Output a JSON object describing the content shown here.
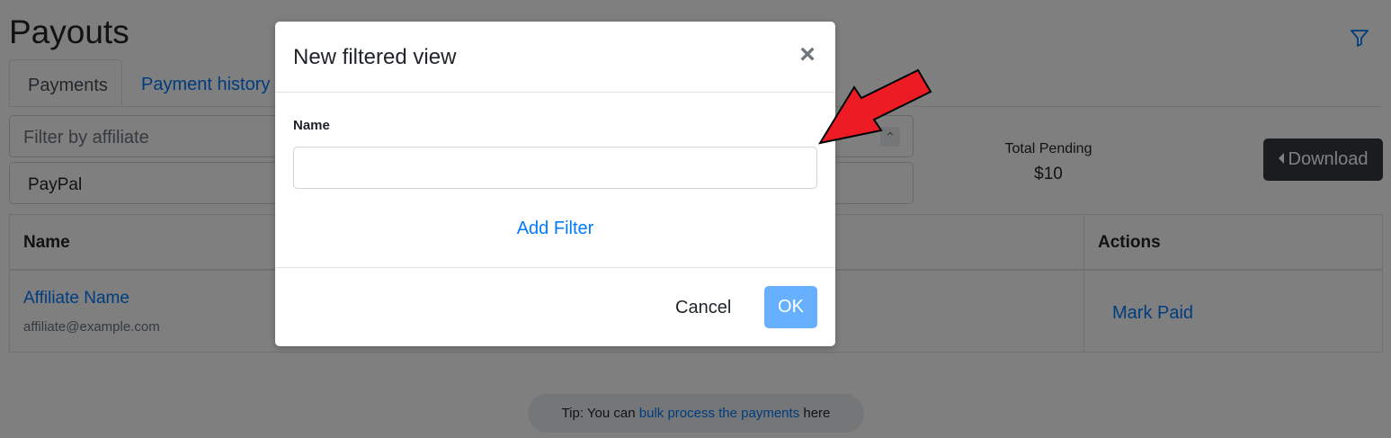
{
  "page": {
    "title": "Payouts",
    "filter_icon": "filter-icon"
  },
  "tabs": [
    {
      "label": "Payments",
      "active": true
    },
    {
      "label": "Payment history",
      "active": false
    }
  ],
  "filters": {
    "affiliate_placeholder": "Filter by affiliate",
    "payment_method": "PayPal"
  },
  "summary": {
    "total_pending_label": "Total Pending",
    "total_pending_value": "$10"
  },
  "download_button": "Download",
  "table": {
    "headers": {
      "name": "Name",
      "actions": "Actions"
    },
    "rows": [
      {
        "name": "Affiliate Name",
        "email": "affiliate@example.com",
        "action": "Mark Paid"
      }
    ]
  },
  "tip": {
    "prefix": "Tip: You can",
    "link": "bulk process the payments",
    "suffix": "here"
  },
  "modal": {
    "title": "New filtered view",
    "close_symbol": "×",
    "name_label": "Name",
    "name_value": "",
    "add_filter": "Add Filter",
    "cancel": "Cancel",
    "ok": "OK"
  },
  "colors": {
    "link": "#007bff",
    "ok_button": "#66b0ff",
    "download_button": "#343a40",
    "annotation_arrow": "#ed1c24"
  }
}
